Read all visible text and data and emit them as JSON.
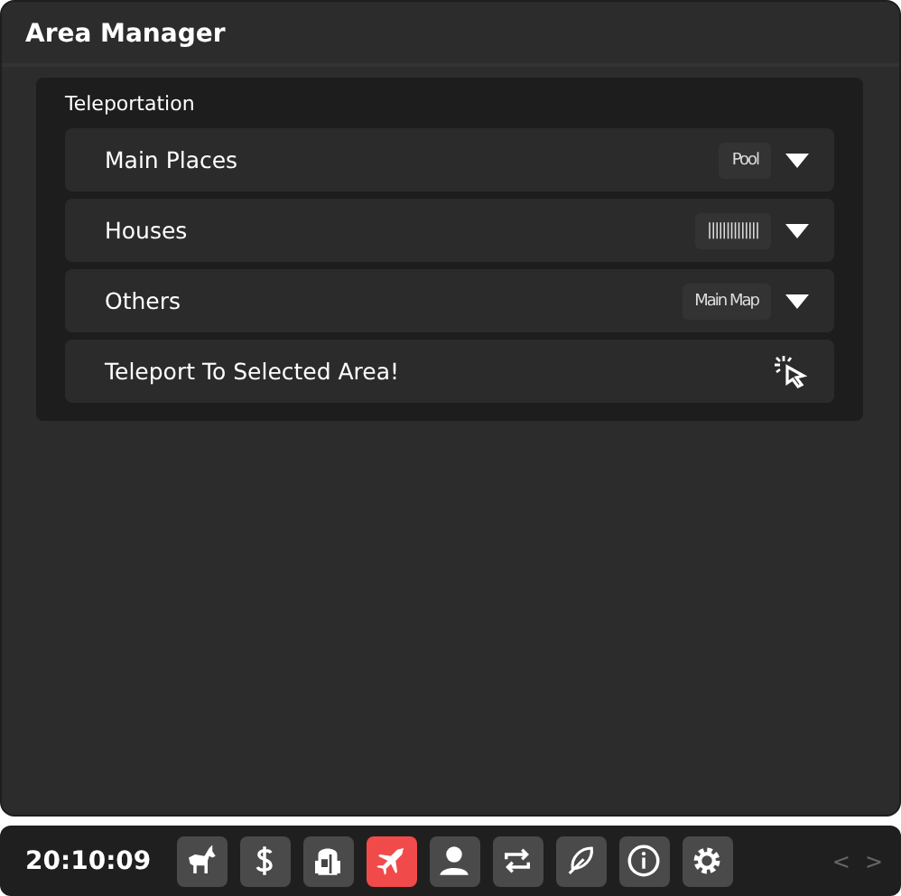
{
  "window": {
    "title": "Area Manager"
  },
  "section": {
    "title": "Teleportation",
    "rows": [
      {
        "kind": "dropdown",
        "label": "Main Places",
        "value": "Pool"
      },
      {
        "kind": "dropdown",
        "label": "Houses",
        "value": "||||||||||||||"
      },
      {
        "kind": "dropdown",
        "label": "Others",
        "value": "Main Map"
      },
      {
        "kind": "action",
        "label": "Teleport To Selected Area!"
      }
    ]
  },
  "taskbar": {
    "time": "20:10:09",
    "buttons": [
      {
        "kind": "horse",
        "selected": false
      },
      {
        "kind": "dollar",
        "selected": false
      },
      {
        "kind": "backpack",
        "selected": false
      },
      {
        "kind": "plane",
        "selected": true
      },
      {
        "kind": "person",
        "selected": false
      },
      {
        "kind": "swap",
        "selected": false
      },
      {
        "kind": "feather",
        "selected": false
      },
      {
        "kind": "info",
        "selected": false
      },
      {
        "kind": "gear",
        "selected": false
      }
    ],
    "prev": "<",
    "next": ">"
  }
}
